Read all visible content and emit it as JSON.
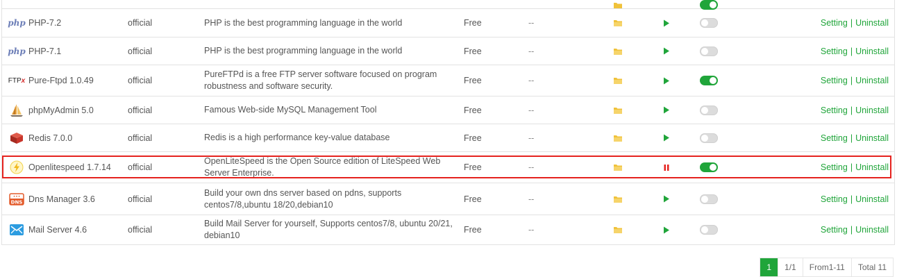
{
  "colors": {
    "accent": "#20a53a",
    "folder": "#f0c23a",
    "stop": "#e5221e",
    "highlight": "#e5221e"
  },
  "rows": [
    {
      "name": "PHP-7.2",
      "icon": "php-icon",
      "developer": "official",
      "description": "PHP is the best programming language in the world",
      "price": "Free",
      "expire": "--",
      "running": true,
      "home_enabled": false,
      "op_setting": "Setting",
      "op_sep": "|",
      "op_uninstall": "Uninstall"
    },
    {
      "name": "PHP-7.1",
      "icon": "php-icon",
      "developer": "official",
      "description": "PHP is the best programming language in the world",
      "price": "Free",
      "expire": "--",
      "running": true,
      "home_enabled": false,
      "op_setting": "Setting",
      "op_sep": "|",
      "op_uninstall": "Uninstall"
    },
    {
      "name": "Pure-Ftpd 1.0.49",
      "icon": "ftp-icon",
      "developer": "official",
      "description": "PureFTPd is a free FTP server software focused on program robustness and software security.",
      "price": "Free",
      "expire": "--",
      "running": true,
      "home_enabled": true,
      "op_setting": "Setting",
      "op_sep": "|",
      "op_uninstall": "Uninstall"
    },
    {
      "name": "phpMyAdmin 5.0",
      "icon": "sailboat-icon",
      "developer": "official",
      "description": "Famous Web-side MySQL Management Tool",
      "price": "Free",
      "expire": "--",
      "running": true,
      "home_enabled": false,
      "op_setting": "Setting",
      "op_sep": "|",
      "op_uninstall": "Uninstall"
    },
    {
      "name": "Redis 7.0.0",
      "icon": "redis-cube-icon",
      "developer": "official",
      "description": "Redis is a high performance key-value database",
      "price": "Free",
      "expire": "--",
      "running": true,
      "home_enabled": false,
      "op_setting": "Setting",
      "op_sep": "|",
      "op_uninstall": "Uninstall"
    },
    {
      "name": "Openlitespeed 1.7.14",
      "icon": "lightning-icon",
      "developer": "official",
      "description": "OpenLiteSpeed is the Open Source edition of LiteSpeed Web Server Enterprise.",
      "price": "Free",
      "expire": "--",
      "running": false,
      "home_enabled": true,
      "op_setting": "Setting",
      "op_sep": "|",
      "op_uninstall": "Uninstall"
    },
    {
      "name": "Dns Manager 3.6",
      "icon": "dns-icon",
      "developer": "official",
      "description": "Build your own dns server based on pdns, supports centos7/8,ubuntu 18/20,debian10",
      "price": "Free",
      "expire": "--",
      "running": true,
      "home_enabled": false,
      "op_setting": "Setting",
      "op_sep": "|",
      "op_uninstall": "Uninstall"
    },
    {
      "name": "Mail Server 4.6",
      "icon": "mail-icon",
      "developer": "official",
      "description": "Build Mail Server for yourself, Supports centos7/8, ubuntu 20/21, debian10",
      "price": "Free",
      "expire": "--",
      "running": true,
      "home_enabled": false,
      "op_setting": "Setting",
      "op_sep": "|",
      "op_uninstall": "Uninstall"
    }
  ],
  "pagination": {
    "current": "1",
    "pages": "1/1",
    "range": "From1-11",
    "total": "Total 11"
  }
}
